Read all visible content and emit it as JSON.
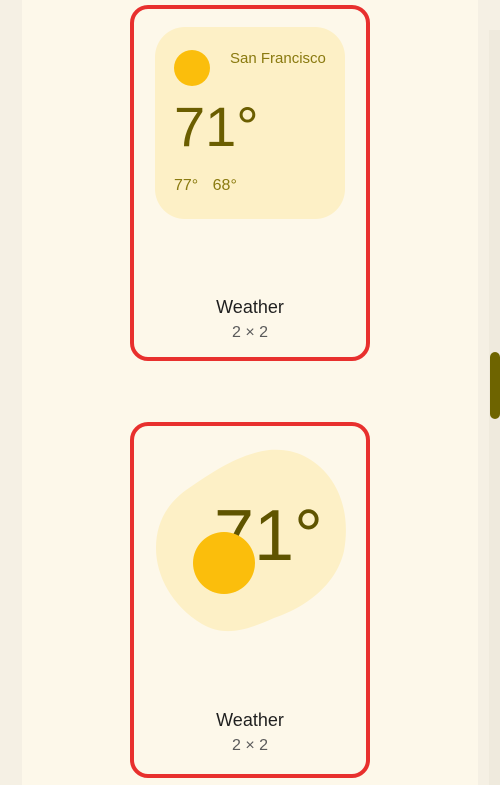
{
  "widgets": [
    {
      "city": "San Francisco",
      "temperature": "71°",
      "high": "77°",
      "low": "68°",
      "name": "Weather",
      "size": "2 × 2",
      "icon": "sun-icon"
    },
    {
      "temperature": "71°",
      "name": "Weather",
      "size": "2 × 2",
      "icon": "sun-icon"
    }
  ],
  "colors": {
    "highlight_border": "#e8302e",
    "widget_background": "#fdf0c6",
    "sun": "#fbbe0c",
    "temperature_text": "#6b5e00",
    "scroll_thumb": "#6e6400"
  }
}
